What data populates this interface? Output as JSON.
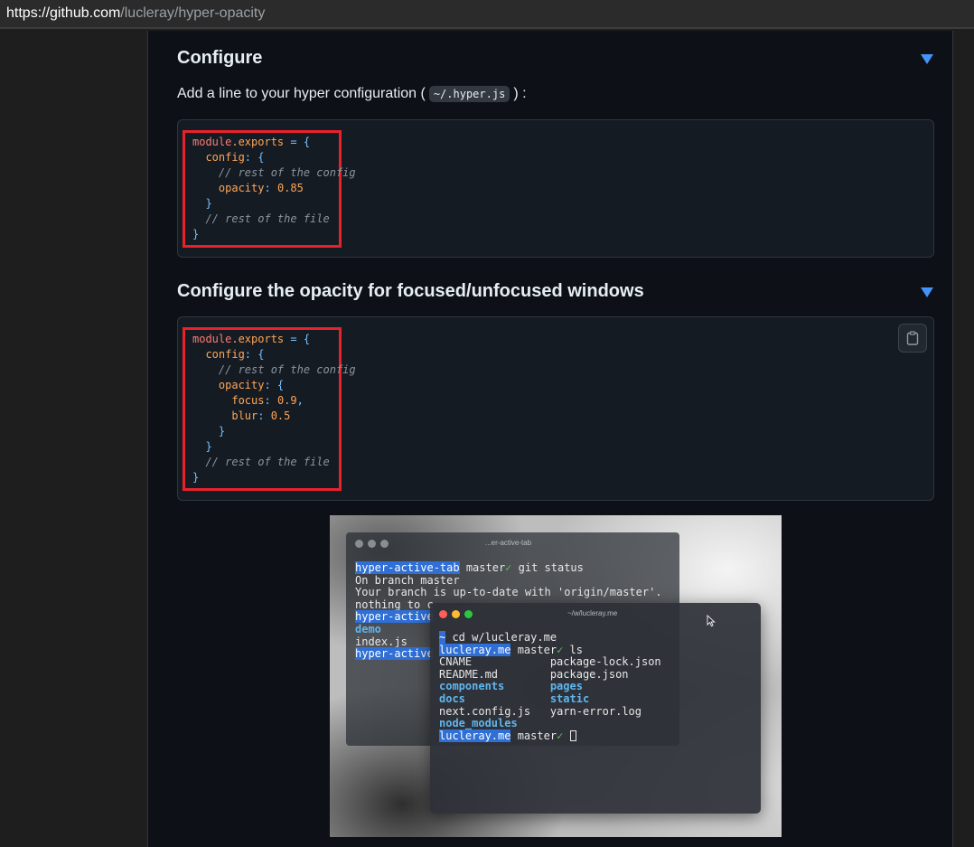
{
  "browser": {
    "url_protocol": "https://",
    "url_host": "github.com",
    "url_path": "/lucleray/hyper-opacity"
  },
  "section1": {
    "heading": "Configure",
    "paragraph_before": "Add a line to your hyper configuration (",
    "paragraph_code": "~/.hyper.js",
    "paragraph_after": ") :",
    "code": {
      "l1_a": "module",
      "l1_b": ".exports",
      "l1_c": " = {",
      "l2_a": "  config",
      "l2_b": ": {",
      "l3": "    // rest of the config",
      "l4_a": "    opacity",
      "l4_b": ": ",
      "l4_c": "0.85",
      "l5": "  }",
      "l6": "  // rest of the file",
      "l7": "}"
    }
  },
  "section2": {
    "heading": "Configure the opacity for focused/unfocused windows",
    "code": {
      "l1_a": "module",
      "l1_b": ".exports",
      "l1_c": " = {",
      "l2_a": "  config",
      "l2_b": ": {",
      "l3": "    // rest of the config",
      "l4_a": "    opacity",
      "l4_b": ": {",
      "l5_a": "      focus",
      "l5_b": ": ",
      "l5_c": "0.9",
      "l5_d": ",",
      "l6_a": "      blur",
      "l6_b": ": ",
      "l6_c": "0.5",
      "l7": "    }",
      "l8": "  }",
      "l9": "  // rest of the file",
      "l10": "}"
    },
    "copy_icon": "clipboard-icon"
  },
  "screenshot": {
    "back_terminal": {
      "title": "...er-active-tab",
      "line1_prompt": "hyper-active-tab",
      "line1_branch": " master",
      "line1_check": "✓",
      "line1_cmd": " git status",
      "line2": "On branch master",
      "line3": "Your branch is up-to-date with 'origin/master'.",
      "line4": "nothing to c",
      "line5_prompt": "hyper-active",
      "line6": "demo",
      "line7": "index.js",
      "line8_prompt": "hyper-active"
    },
    "front_terminal": {
      "title": "~/w/lucleray.me",
      "l1_tilde": "~",
      "l1_cmd": " cd w/lucleray.me",
      "l2_prompt": "lucleray.me",
      "l2_branch": " master",
      "l2_check": "✓",
      "l2_cmd": " ls",
      "files_left": [
        "CNAME",
        "README.md",
        "components",
        "docs",
        "next.config.js",
        "node_modules"
      ],
      "files_right": [
        "package-lock.json",
        "package.json",
        "pages",
        "static",
        "yarn-error.log"
      ],
      "l9_prompt": "lucleray.me",
      "l9_branch": " master",
      "l9_check": "✓"
    },
    "colors": {
      "red": "#ff5f57",
      "yellow": "#febc2e",
      "green": "#28c840",
      "highlight": "#2f6fd6"
    }
  }
}
